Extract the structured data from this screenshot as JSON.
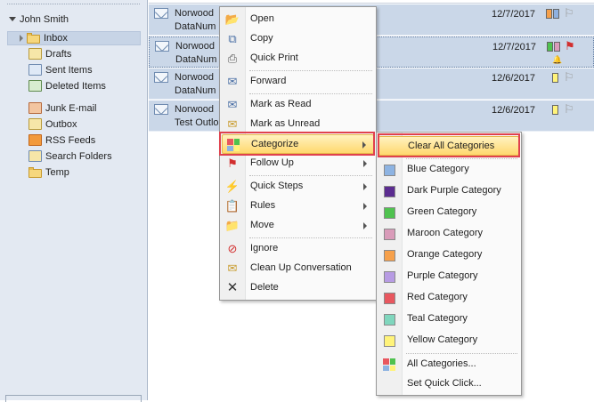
{
  "nav": {
    "account": "John Smith",
    "folders": [
      {
        "name": "Inbox",
        "icon": "inbox-folder-icon",
        "selected": true
      },
      {
        "name": "Drafts",
        "icon": "drafts-icon"
      },
      {
        "name": "Sent Items",
        "icon": "sent-items-icon"
      },
      {
        "name": "Deleted Items",
        "icon": "deleted-items-icon"
      },
      {
        "name": "Junk E-mail",
        "icon": "junk-email-icon"
      },
      {
        "name": "Outbox",
        "icon": "outbox-icon"
      },
      {
        "name": "RSS Feeds",
        "icon": "rss-feeds-icon"
      },
      {
        "name": "Search Folders",
        "icon": "search-folders-icon"
      },
      {
        "name": "Temp",
        "icon": "folder-icon"
      }
    ]
  },
  "messages": [
    {
      "from": "Norwood",
      "subject": "DataNum",
      "date": "12/7/2017",
      "categories": [
        "#f6a04a",
        "#8fb1e0"
      ],
      "flag": "outline"
    },
    {
      "from": "Norwood",
      "subject": "DataNum",
      "date": "12/7/2017",
      "categories": [
        "#4fc24f",
        "#d99bb9"
      ],
      "flag": "red",
      "reminder": true
    },
    {
      "from": "Norwood",
      "subject": "DataNum",
      "date": "12/6/2017",
      "categories": [
        "#fff37a"
      ],
      "flag": "outline"
    },
    {
      "from": "Norwood",
      "subject": "Test Outlo",
      "date": "12/6/2017",
      "categories": [
        "#fff37a"
      ],
      "flag": "outline"
    }
  ],
  "context_menu": {
    "items": [
      {
        "label": "Open",
        "icon": "open-icon"
      },
      {
        "label": "Copy",
        "icon": "copy-icon"
      },
      {
        "label": "Quick Print",
        "icon": "print-icon"
      },
      {
        "label": "Forward",
        "icon": "forward-icon"
      },
      {
        "label": "Mark as Read",
        "icon": "mark-read-icon"
      },
      {
        "label": "Mark as Unread",
        "icon": "mark-unread-icon"
      },
      {
        "label": "Categorize",
        "icon": "categorize-icon",
        "submenu": true,
        "highlighted": true
      },
      {
        "label": "Follow Up",
        "icon": "follow-up-flag-icon",
        "submenu": true
      },
      {
        "label": "Quick Steps",
        "icon": "quick-steps-icon",
        "submenu": true
      },
      {
        "label": "Rules",
        "icon": "rules-icon",
        "submenu": true
      },
      {
        "label": "Move",
        "icon": "move-icon",
        "submenu": true
      },
      {
        "label": "Ignore",
        "icon": "ignore-icon"
      },
      {
        "label": "Clean Up Conversation",
        "icon": "clean-up-icon"
      },
      {
        "label": "Delete",
        "icon": "delete-icon"
      }
    ]
  },
  "categorize_menu": {
    "clear_all": "Clear All Categories",
    "categories": [
      {
        "label": "Blue Category",
        "color": "#8db3e2"
      },
      {
        "label": "Dark Purple Category",
        "color": "#5b2c90"
      },
      {
        "label": "Green Category",
        "color": "#4fc24f"
      },
      {
        "label": "Maroon Category",
        "color": "#d99bb9"
      },
      {
        "label": "Orange Category",
        "color": "#f6a04a"
      },
      {
        "label": "Purple Category",
        "color": "#b79be3"
      },
      {
        "label": "Red Category",
        "color": "#e8575f"
      },
      {
        "label": "Teal Category",
        "color": "#7fd6bd"
      },
      {
        "label": "Yellow Category",
        "color": "#fff37a"
      }
    ],
    "all_categories": "All Categories...",
    "set_quick_click": "Set Quick Click..."
  }
}
